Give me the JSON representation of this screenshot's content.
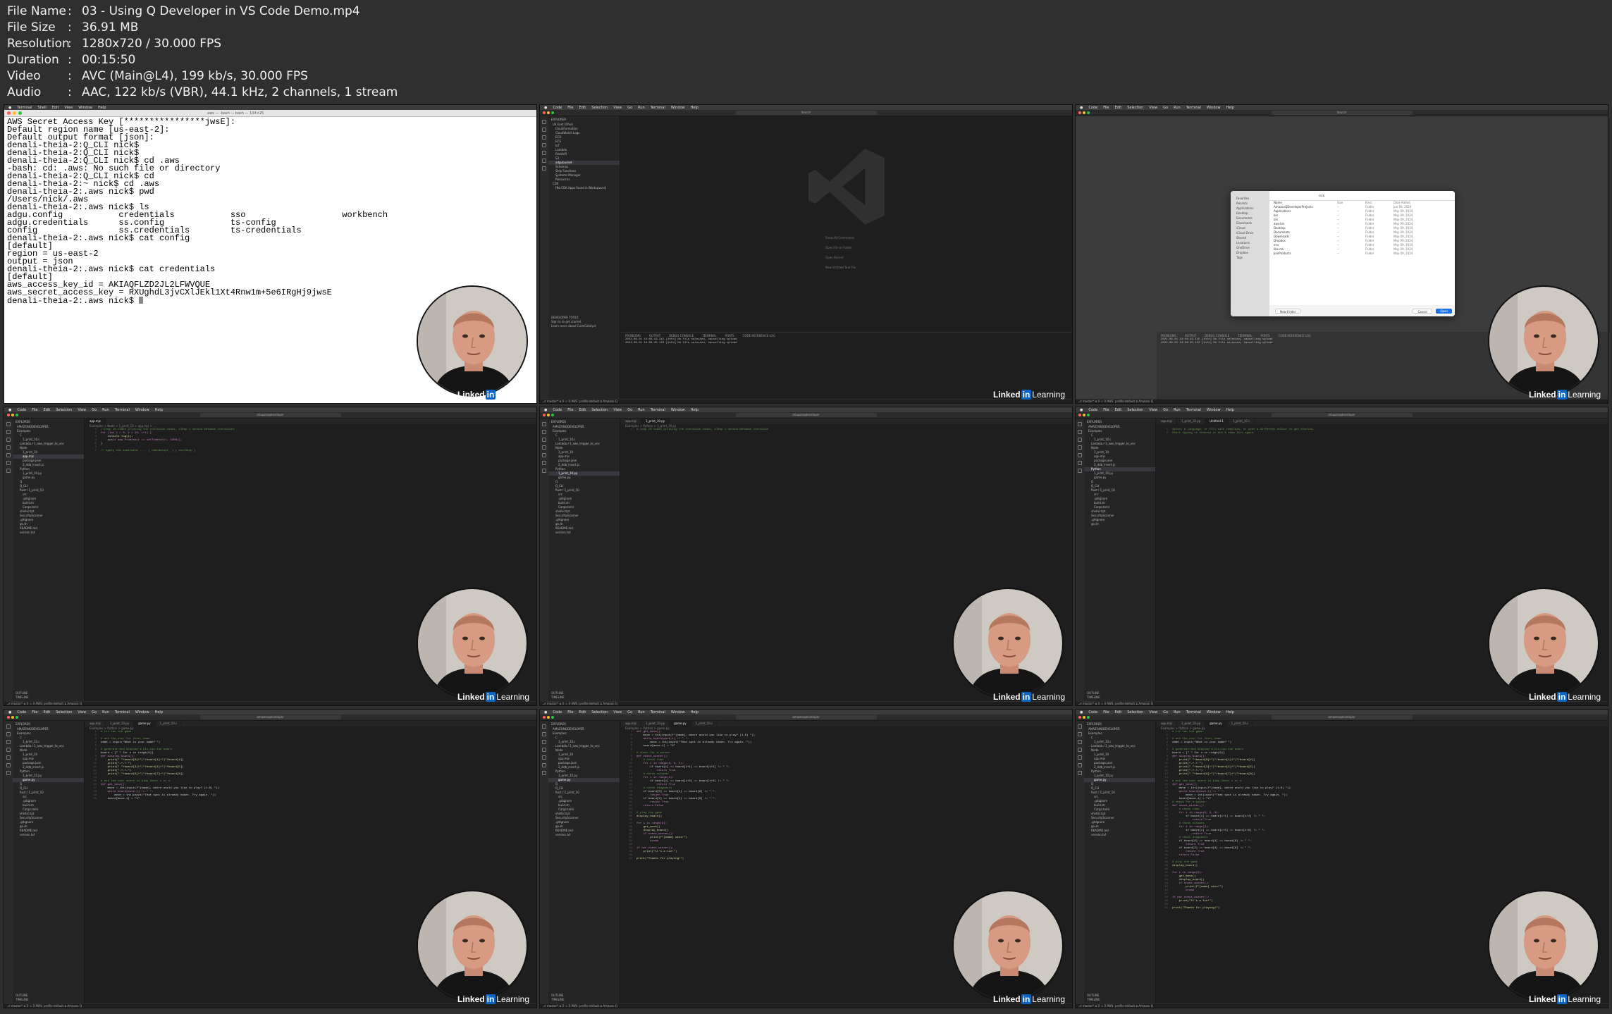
{
  "meta": {
    "rows": [
      {
        "key": "File Name",
        "value": "03 - Using Q Developer in VS Code Demo.mp4"
      },
      {
        "key": "File Size",
        "value": "36.91 MB"
      },
      {
        "key": "Resolution",
        "value": "1280x720 / 30.000 FPS"
      },
      {
        "key": "Duration",
        "value": "00:15:50"
      },
      {
        "key": "Video",
        "value": "AVC (Main@L4), 199 kb/s, 30.000 FPS"
      },
      {
        "key": "Audio",
        "value": "AAC, 122 kb/s (VBR), 44.1 kHz, 2 channels, 1 stream"
      }
    ],
    "separator": ":"
  },
  "brand": {
    "linked": "Linked",
    "in": "in",
    "learning": "Learning"
  },
  "terminal": {
    "title": "aws — -bash — bash — 104×25",
    "lines": [
      "AWS Secret Access Key [****************jwsE]:",
      "Default region name [us-east-2]:",
      "Default output format [json]:",
      "denali-theia-2:Q_CLI nick$",
      "denali-theia-2:Q_CLI nick$",
      "denali-theia-2:Q_CLI nick$ cd .aws",
      "-bash: cd: .aws: No such file or directory",
      "denali-theia-2:Q_CLI nick$ cd",
      "denali-theia-2:~ nick$ cd .aws",
      "denali-theia-2:.aws nick$ pwd",
      "/Users/nick/.aws",
      "denali-theia-2:.aws nick$ ls",
      "adgu.config           credentials           sso                   workbench",
      "adgu.credentials      ss.config             ts-config",
      "config                ss.credentials        ts-credentials",
      "denali-theia-2:.aws nick$ cat config",
      "[default]",
      "region = us-east-2",
      "output = json",
      "denali-theia-2:.aws nick$ cat credentials",
      "[default]",
      "aws_access_key_id = AKIAQFLZD2JL2LFWVQUE",
      "aws_secret_access_key = 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",
      "denali-theia-2:.aws nick$ "
    ]
  },
  "menubar": {
    "terminal": [
      "Terminal",
      "Shell",
      "Edit",
      "View",
      "Window",
      "Help"
    ],
    "code": [
      "Code",
      "File",
      "Edit",
      "Selection",
      "View",
      "Go",
      "Run",
      "Terminal",
      "Window",
      "Help"
    ]
  },
  "vscode": {
    "search_label": "Search",
    "search_label_2": "amazonqdeveloper",
    "explorer_label": "EXPLORER",
    "aws_label": "AWS",
    "outline": [
      "OUTLINE",
      "TIMELINE"
    ],
    "aws_tree": [
      "US East (Ohio)",
      "CloudFormation",
      "CloudWatch Logs",
      "ECR",
      "ECS",
      "IoT",
      "Lambda",
      "Redshift",
      "S3",
      "adgubucket",
      "Schemas",
      "Step Functions",
      "Systems Manager",
      "Resources"
    ],
    "cdk_label": "CDK",
    "cdk_item": "[No CDK Apps found in Workspaces]",
    "codewhisperer": [
      "DEVELOPER TOOLS",
      "Sign in to get started",
      "Learn more about CodeCatalyst"
    ],
    "welcome_hints": [
      "Show All Commands",
      "Open File or Folder",
      "Open Recent",
      "New Untitled Text File"
    ],
    "panel_tabs": [
      "PROBLEMS",
      "OUTPUT",
      "DEBUG CONSOLE",
      "TERMINAL",
      "PORTS",
      "CODE REFERENCE LOG"
    ],
    "panel_log": [
      "2024-06-01 14:04:43.215 [info] No file selected, cancelling upload",
      "2024-06-01 14:04:45.123 [info] No file selected, cancelling upload"
    ],
    "status": "⎇ master*  ⊗ 0 ⚠ 0   AWS: profile:default   ⧖ Amazon Q",
    "tree": [
      "AMAZONQDEVELOPER",
      "Examples",
      "C",
      "1_print_10.c",
      "Lambda / 1_aws_trigger_to_sns",
      "Node",
      "1_print_10",
      "app.mjs",
      "package.json",
      "2_ddb_insert.js",
      "Python",
      "1_print_10.py",
      "game.py",
      "Q",
      "Q_CLI",
      "Rust / 1_print_10",
      "src",
      ".gitignore",
      "build.sh",
      "Cargo.toml",
      "shellscript",
      "SecurityScanner",
      ".gitignore",
      "go.sh",
      "README.md",
      "version.txt"
    ],
    "js_code": [
      {
        "t": "cm",
        "s": "//Loop 10 times printing the iteration count, sleep 1 second between iterations"
      },
      {
        "t": "kw",
        "s": "for (let i = 0; i < 10; i++) {"
      },
      {
        "t": "fn",
        "s": "    console.log(i);"
      },
      {
        "t": "kw",
        "s": "    await new Promise(r => setTimeout(r, 1000));"
      },
      {
        "t": "",
        "s": "}"
      },
      {
        "t": "",
        "s": ""
      },
      {
        "t": "cm",
        "s": "// apply the available ...  ( tab=Accept  ) ( esc=Skip )"
      }
    ],
    "py_code_1": [
      {
        "t": "cm",
        "s": "# loop 10 times printing the iteration count, sleep 1 second between iteration"
      }
    ],
    "untitled_code": [
      {
        "t": "cm",
        "s": "Select a language, or fill with template, or open a different editor to get started."
      },
      {
        "t": "cm",
        "s": "Start typing to dismiss or don't show this again."
      }
    ],
    "game_code": [
      {
        "t": "cm",
        "s": "# tic tac toe game"
      },
      {
        "t": "",
        "s": ""
      },
      {
        "t": "cm",
        "s": "# ask the user for thier name"
      },
      {
        "t": "",
        "s": "name = input(\"What is your name? \")"
      },
      {
        "t": "",
        "s": ""
      },
      {
        "t": "cm",
        "s": "# generate and display a tic-tac-toe board"
      },
      {
        "t": "",
        "s": "board = [\" \" for x in range(9)]"
      },
      {
        "t": "kw",
        "s": "def display_board():"
      },
      {
        "t": "fn",
        "s": "    print(\" \"+board[0]+\"|\"+board[1]+\"|\"+board[2])"
      },
      {
        "t": "fn",
        "s": "    print(\"-+-+-\")"
      },
      {
        "t": "fn",
        "s": "    print(\" \"+board[3]+\"|\"+board[4]+\"|\"+board[5])"
      },
      {
        "t": "fn",
        "s": "    print(\"-+-+-\")"
      },
      {
        "t": "fn",
        "s": "    print(\" \"+board[6]+\"|\"+board[7]+\"|\"+board[8])"
      },
      {
        "t": "",
        "s": ""
      },
      {
        "t": "cm",
        "s": "# ask the user where to play their x or o"
      },
      {
        "t": "kw",
        "s": "def get_move():"
      },
      {
        "t": "",
        "s": "    move = int(input(f\"{name}, where would you like to play? (1-9) \"))"
      },
      {
        "t": "kw",
        "s": "    while board[move-1] != \" \":"
      },
      {
        "t": "",
        "s": "        move = int(input(\"That spot is already taken. Try again. \"))"
      },
      {
        "t": "",
        "s": "    board[move-1] = \"X\""
      }
    ],
    "game_code_2": [
      {
        "t": "kw",
        "s": "def get_move():"
      },
      {
        "t": "",
        "s": "    move = int(input(f\"{name}, where would you like to play? (1-9) \"))"
      },
      {
        "t": "kw",
        "s": "    while board[move-1] != \" \":"
      },
      {
        "t": "",
        "s": "        move = int(input(\"That spot is already taken. Try again. \"))"
      },
      {
        "t": "",
        "s": "    board[move-1] = \"X\""
      },
      {
        "t": "",
        "s": ""
      },
      {
        "t": "cm",
        "s": "# check for a winner"
      },
      {
        "t": "kw",
        "s": "def check_winner():"
      },
      {
        "t": "cm",
        "s": "    # check rows"
      },
      {
        "t": "kw",
        "s": "    for i in range(0, 9, 3):"
      },
      {
        "t": "",
        "s": "        if board[i] == board[i+1] == board[i+2] != \" \":"
      },
      {
        "t": "kw",
        "s": "            return True"
      },
      {
        "t": "cm",
        "s": "    # check columns"
      },
      {
        "t": "kw",
        "s": "    for i in range(3):"
      },
      {
        "t": "",
        "s": "        if board[i] == board[i+3] == board[i+6] != \" \":"
      },
      {
        "t": "kw",
        "s": "            return True"
      },
      {
        "t": "cm",
        "s": "    # check diagonals"
      },
      {
        "t": "",
        "s": "    if board[0] == board[4] == board[8] != \" \":"
      },
      {
        "t": "kw",
        "s": "        return True"
      },
      {
        "t": "",
        "s": "    if board[2] == board[4] == board[6] != \" \":"
      },
      {
        "t": "kw",
        "s": "        return True"
      },
      {
        "t": "kw",
        "s": "    return False"
      },
      {
        "t": "",
        "s": ""
      },
      {
        "t": "cm",
        "s": "# play the game"
      },
      {
        "t": "fn",
        "s": "display_board()"
      },
      {
        "t": "",
        "s": ""
      },
      {
        "t": "kw",
        "s": "for i in range(9):"
      },
      {
        "t": "fn",
        "s": "    get_move()"
      },
      {
        "t": "fn",
        "s": "    display_board()"
      },
      {
        "t": "kw",
        "s": "    if check_winner():"
      },
      {
        "t": "fn",
        "s": "        print(f\"{name} wins!\")"
      },
      {
        "t": "kw",
        "s": "        break"
      },
      {
        "t": "",
        "s": ""
      },
      {
        "t": "kw",
        "s": "if not check_winner():"
      },
      {
        "t": "fn",
        "s": "    print(\"It's a tie!\")"
      },
      {
        "t": "",
        "s": ""
      },
      {
        "t": "fn",
        "s": "print(\"Thanks for playing!\")"
      }
    ]
  },
  "dialog": {
    "sidebar": [
      "Favorites",
      "Recents",
      "Applications",
      "Desktop",
      "Documents",
      "Downloads",
      "iCloud",
      "iCloud Drive",
      "Shared",
      "Locations",
      "OneDrive",
      "Dropbox",
      "Tags"
    ],
    "path": "nick",
    "search": "Search",
    "cols": [
      "Name",
      "Size",
      "Kind",
      "Date Added"
    ],
    "rows": [
      [
        "AmazonQDeveloperProjects",
        "--",
        "Folder",
        "Jun 06, 2024"
      ],
      [
        "Applications",
        "--",
        "Folder",
        "May 09, 2024"
      ],
      [
        "bin",
        "--",
        "Folder",
        "May 09, 2024"
      ],
      [
        "bin",
        "--",
        "Folder",
        "May 09, 2024"
      ],
      [
        "aws-bin",
        "--",
        "Folder",
        "May 09, 2024"
      ],
      [
        "Desktop",
        "--",
        "Folder",
        "May 09, 2024"
      ],
      [
        "Documents",
        "--",
        "Folder",
        "May 09, 2024"
      ],
      [
        "Downloads",
        "--",
        "Folder",
        "May 09, 2024"
      ],
      [
        "Dropbox",
        "--",
        "Folder",
        "May 09, 2024"
      ],
      [
        "env",
        "--",
        "Folder",
        "May 09, 2024"
      ],
      [
        "libs.mk",
        "--",
        "Folder",
        "May 09, 2024"
      ],
      [
        "JoinProducts",
        "--",
        "Folder",
        "May 09, 2024"
      ]
    ],
    "new_folder": "New Folder",
    "cancel": "Cancel",
    "open": "Open"
  },
  "colors": {
    "background": "#2f2f2f",
    "vscode_bg": "#1e1e1e",
    "sidebar_bg": "#252526",
    "linkedin_blue": "#0a66c2",
    "skin": "#d79a82",
    "shirt": "#151515"
  }
}
